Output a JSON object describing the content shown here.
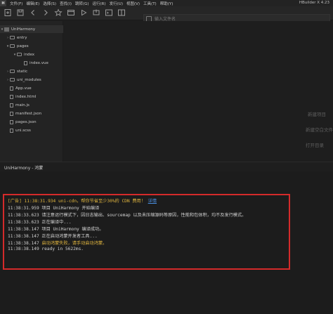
{
  "app": {
    "logo": "H",
    "title": "HBuilder X 4.23"
  },
  "menu": [
    "文件(F)",
    "编辑(E)",
    "选择(S)",
    "查找(I)",
    "跳转(G)",
    "运行(R)",
    "发行(U)",
    "视图(V)",
    "工具(T)",
    "帮助(Y)"
  ],
  "toolbar": {
    "address_placeholder": "输入文件名"
  },
  "tree": {
    "project": "UniHarmony",
    "items": [
      {
        "label": "entry",
        "type": "folder",
        "expanded": false
      },
      {
        "label": "pages",
        "type": "folder",
        "expanded": true
      },
      {
        "label": "index",
        "type": "folder",
        "expanded": true
      },
      {
        "label": "index.vue",
        "type": "file"
      },
      {
        "label": "static",
        "type": "folder",
        "expanded": false
      },
      {
        "label": "uni_modules",
        "type": "folder",
        "expanded": false
      },
      {
        "label": "App.vue",
        "type": "file"
      },
      {
        "label": "index.html",
        "type": "file"
      },
      {
        "label": "main.js",
        "type": "file"
      },
      {
        "label": "manifest.json",
        "type": "file"
      },
      {
        "label": "pages.json",
        "type": "file"
      },
      {
        "label": "uni.scss",
        "type": "file"
      }
    ]
  },
  "welcome": {
    "new_project": "新建项目",
    "new_blank_file": "新建空白文件",
    "open_directory": "打开目录"
  },
  "console": {
    "tab": "UniHarmony - 鸿蒙",
    "ad": {
      "prefix": "[广告] 11:38:31.934 uni-cdn，帮你节省至少30%的 CDN 费用！",
      "link": "详情"
    },
    "lines": [
      "11:38:31.959 项目 UniHarmony 开始编译",
      "11:38:33.623 请注意运行模式下，因日志输出、sourcemap 以及未压缩源码等原因，性能和包体积，均不及发行模式。",
      "11:38:33.623 正在编译中...",
      "11:38:38.147 项目 UniHarmony 编译成功。",
      "11:38:38.147 正在启动鸿蒙开发者工具..."
    ],
    "warn": {
      "time": "11:38:38.147",
      "text": "启动鸿蒙失败，请手动启动鸿蒙。"
    },
    "ready": "11:38:38.149 ready in 5622ms."
  }
}
